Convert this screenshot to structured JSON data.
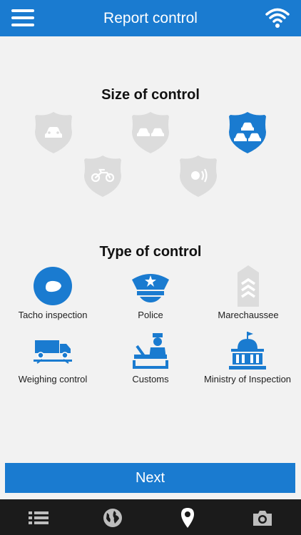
{
  "header": {
    "title": "Report control",
    "menu_icon": "menu-icon",
    "wifi_icon": "wifi-icon",
    "color": "#1a7bd0"
  },
  "size_section": {
    "title": "Size of control",
    "options": [
      {
        "icon": "single-car-badge-icon",
        "selected": false
      },
      {
        "icon": "two-cars-badge-icon",
        "selected": false
      },
      {
        "icon": "three-cars-badge-icon",
        "selected": true
      },
      {
        "icon": "motorcycle-badge-icon",
        "selected": false
      },
      {
        "icon": "speed-camera-badge-icon",
        "selected": false
      }
    ],
    "selected_color": "#1a7bd0",
    "unselected_color": "#dcdcdc"
  },
  "type_section": {
    "title": "Type of control",
    "items": [
      {
        "label": "Tacho inspection",
        "icon": "tachograph-icon"
      },
      {
        "label": "Police",
        "icon": "police-cap-icon"
      },
      {
        "label": "Marechaussee",
        "icon": "rank-insignia-icon"
      },
      {
        "label": "Weighing control",
        "icon": "truck-scale-icon"
      },
      {
        "label": "Customs",
        "icon": "customs-officer-icon"
      },
      {
        "label": "Ministry of Inspection",
        "icon": "government-building-icon"
      }
    ]
  },
  "next_button": {
    "label": "Next"
  },
  "bottom_nav": {
    "items": [
      {
        "icon": "list-icon"
      },
      {
        "icon": "globe-icon"
      },
      {
        "icon": "location-pin-icon"
      },
      {
        "icon": "camera-icon"
      }
    ]
  }
}
